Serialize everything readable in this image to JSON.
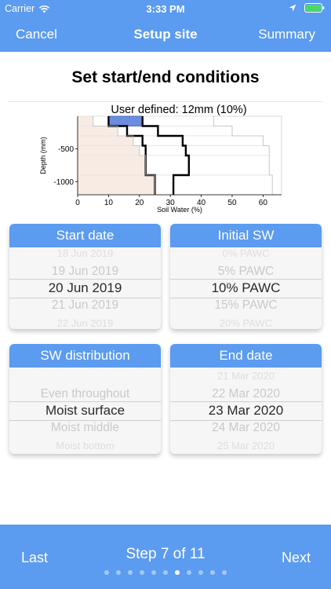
{
  "status_bar": {
    "carrier": "Carrier",
    "time": "3:33 PM"
  },
  "nav": {
    "left": "Cancel",
    "title": "Setup site",
    "right": "Summary"
  },
  "heading": "Set start/end conditions",
  "chart": {
    "title": "User defined: 12mm (10%)",
    "xlabel": "Soil Water (%)",
    "ylabel": "Depth (mm)",
    "x_ticks": [
      "0",
      "10",
      "20",
      "30",
      "40",
      "50",
      "60"
    ],
    "y_ticks": [
      "-500",
      "-1000"
    ],
    "accent": "#6b8de0"
  },
  "chart_data": {
    "type": "line",
    "title": "User defined: 12mm (10%)",
    "xlabel": "Soil Water (%)",
    "ylabel": "Depth (mm)",
    "xlim": [
      0,
      66
    ],
    "ylim": [
      -1200,
      0
    ],
    "series": [
      {
        "values": [
          [
            10,
            0
          ],
          [
            10,
            -150
          ],
          [
            16,
            -150
          ],
          [
            16,
            -300
          ],
          [
            21,
            -300
          ],
          [
            21,
            -450
          ],
          [
            22,
            -450
          ],
          [
            22,
            -600
          ],
          [
            22,
            -600
          ],
          [
            22,
            -900
          ],
          [
            25,
            -900
          ],
          [
            25,
            -1200
          ]
        ]
      },
      {
        "values": [
          [
            21,
            0
          ],
          [
            21,
            -150
          ],
          [
            26,
            -150
          ],
          [
            26,
            -300
          ],
          [
            34,
            -300
          ],
          [
            34,
            -450
          ],
          [
            35,
            -450
          ],
          [
            35,
            -600
          ],
          [
            36,
            -600
          ],
          [
            36,
            -900
          ],
          [
            31,
            -900
          ],
          [
            31,
            -1200
          ]
        ]
      },
      {
        "values": [
          [
            5,
            0
          ],
          [
            5,
            -150
          ],
          [
            13,
            -150
          ],
          [
            13,
            -300
          ],
          [
            18,
            -300
          ],
          [
            18,
            -450
          ],
          [
            20,
            -450
          ],
          [
            20,
            -600
          ],
          [
            22,
            -600
          ],
          [
            22,
            -900
          ],
          [
            25,
            -900
          ],
          [
            25,
            -1200
          ]
        ]
      },
      {
        "values": [
          [
            44,
            0
          ],
          [
            44,
            -150
          ],
          [
            50,
            -150
          ],
          [
            50,
            -300
          ],
          [
            60,
            -300
          ],
          [
            60,
            -450
          ],
          [
            62,
            -450
          ],
          [
            62,
            -600
          ],
          [
            62,
            -600
          ],
          [
            62,
            -900
          ],
          [
            63,
            -900
          ],
          [
            63,
            -1200
          ]
        ]
      },
      {
        "values": [
          [
            10,
            -150
          ],
          [
            21,
            -150
          ]
        ]
      }
    ]
  },
  "pickers": {
    "start_date": {
      "title": "Start date",
      "items": [
        "18 Jun 2019",
        "19 Jun 2019",
        "20 Jun 2019",
        "21 Jun 2019",
        "22 Jun 2019"
      ],
      "selected": 2
    },
    "initial_sw": {
      "title": "Initial SW",
      "items": [
        "0% PAWC",
        "5% PAWC",
        "10% PAWC",
        "15% PAWC",
        "20% PAWC"
      ],
      "selected": 2
    },
    "sw_distribution": {
      "title": "SW distribution",
      "items": [
        "",
        "Even throughout",
        "Moist surface",
        "Moist middle",
        "Moist bottom"
      ],
      "selected": 2
    },
    "end_date": {
      "title": "End date",
      "items": [
        "21 Mar 2020",
        "22 Mar 2020",
        "23 Mar 2020",
        "24 Mar 2020",
        "25 Mar 2020"
      ],
      "selected": 2
    }
  },
  "bottom": {
    "left": "Last",
    "step": "Step 7 of 11",
    "right": "Next",
    "page_current": 7,
    "page_total": 11
  }
}
